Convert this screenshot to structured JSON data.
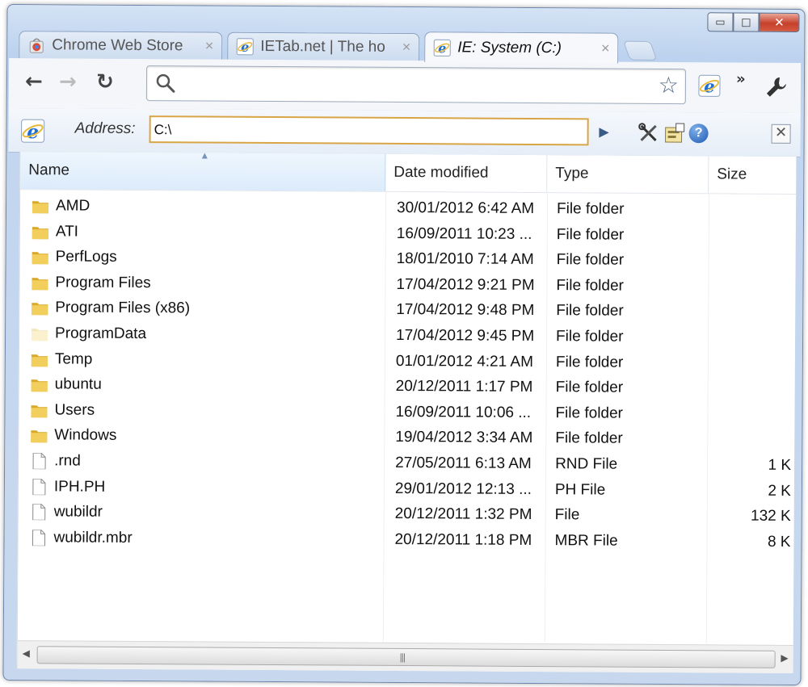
{
  "window": {
    "caption_buttons": [
      "▭",
      "□",
      "✕"
    ]
  },
  "tabs": [
    {
      "label": "Chrome Web Store",
      "icon": "chrome-webstore-icon",
      "close": "×",
      "active": false
    },
    {
      "label": "IETab.net | The ho",
      "icon": "ie-icon",
      "close": "×",
      "active": false
    },
    {
      "label": "IE: System (C:)",
      "icon": "ie-icon",
      "close": "×",
      "active": true
    }
  ],
  "toolbar": {
    "back": "←",
    "forward": "→",
    "reload": "↻",
    "omnibox_value": "",
    "more": "»"
  },
  "address_bar": {
    "label": "Address:",
    "value": "C:\\",
    "go": "▶",
    "help": "?",
    "close": "✕"
  },
  "explorer": {
    "columns": [
      "Name",
      "Date modified",
      "Type",
      "Size"
    ],
    "sorted_column": "Name",
    "rows": [
      {
        "name": "AMD",
        "date": "30/01/2012 6:42 AM",
        "type": "File folder",
        "size": "",
        "kind": "folder"
      },
      {
        "name": "ATI",
        "date": "16/09/2011 10:23 ...",
        "type": "File folder",
        "size": "",
        "kind": "folder"
      },
      {
        "name": "PerfLogs",
        "date": "18/01/2010 7:14 AM",
        "type": "File folder",
        "size": "",
        "kind": "folder"
      },
      {
        "name": "Program Files",
        "date": "17/04/2012 9:21 PM",
        "type": "File folder",
        "size": "",
        "kind": "folder"
      },
      {
        "name": "Program Files (x86)",
        "date": "17/04/2012 9:48 PM",
        "type": "File folder",
        "size": "",
        "kind": "folder"
      },
      {
        "name": "ProgramData",
        "date": "17/04/2012 9:45 PM",
        "type": "File folder",
        "size": "",
        "kind": "folder-hidden"
      },
      {
        "name": "Temp",
        "date": "01/01/2012 4:21 AM",
        "type": "File folder",
        "size": "",
        "kind": "folder"
      },
      {
        "name": "ubuntu",
        "date": "20/12/2011 1:17 PM",
        "type": "File folder",
        "size": "",
        "kind": "folder"
      },
      {
        "name": "Users",
        "date": "16/09/2011 10:06 ...",
        "type": "File folder",
        "size": "",
        "kind": "folder"
      },
      {
        "name": "Windows",
        "date": "19/04/2012 3:34 AM",
        "type": "File folder",
        "size": "",
        "kind": "folder"
      },
      {
        "name": ".rnd",
        "date": "27/05/2011 6:13 AM",
        "type": "RND File",
        "size": "1 K",
        "kind": "file"
      },
      {
        "name": "IPH.PH",
        "date": "29/01/2012 12:13 ...",
        "type": "PH File",
        "size": "2 K",
        "kind": "file"
      },
      {
        "name": "wubildr",
        "date": "20/12/2011 1:32 PM",
        "type": "File",
        "size": "132 K",
        "kind": "file"
      },
      {
        "name": "wubildr.mbr",
        "date": "20/12/2011 1:18 PM",
        "type": "MBR File",
        "size": "8 K",
        "kind": "file"
      }
    ]
  },
  "scrollbar": {
    "left_arrow": "◀",
    "right_arrow": "▶",
    "grip": "|||"
  },
  "colors": {
    "folder_yellow": "#e8c24a",
    "ie_blue": "#1f6fd0",
    "address_border": "#d8a546"
  }
}
